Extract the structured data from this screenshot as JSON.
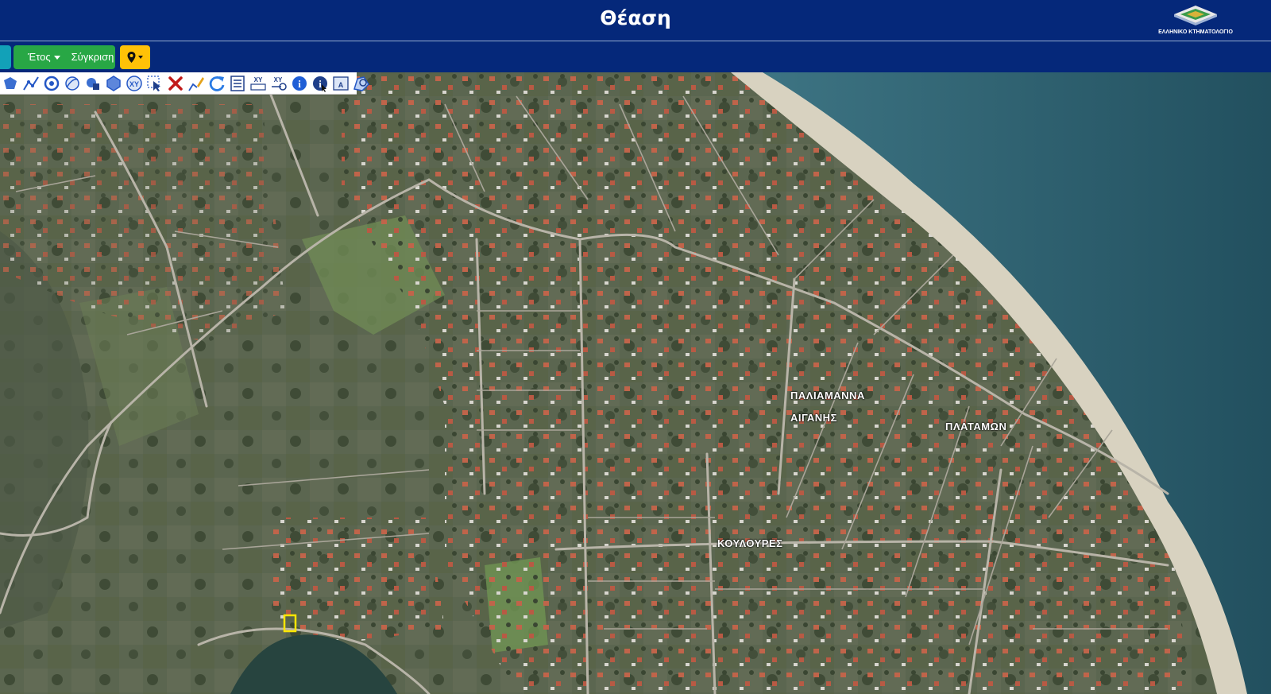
{
  "header": {
    "title": "Θέαση",
    "logo_text": "ΕΛΛΗΝΙΚΟ ΚΤΗΜΑΤΟΛΟΓΙΟ"
  },
  "navbar": {
    "year_label": "Έτος",
    "compare_label": "Σύγκριση",
    "location_icon": "map-marker-icon"
  },
  "toolbar": {
    "tools": [
      "polygon-tool-icon",
      "polyline-tool-icon",
      "circle-tool-icon",
      "freehand-tool-icon",
      "draw-shape-icon",
      "hexagon-tool-icon",
      "xy-point-icon",
      "select-tool-icon",
      "delete-tool-icon",
      "edit-tool-icon",
      "refresh-icon",
      "list-icon",
      "xy-coordinates-icon",
      "xy-goto-icon",
      "info-icon",
      "identify-icon",
      "text-annotation-icon",
      "area-measure-icon"
    ]
  },
  "map": {
    "labels": {
      "paliamanna": "ΠΑΛΙΑΜΑΝΝΑ",
      "aiganis": "ΑΙΓΑΝΗΣ",
      "platamon": "ΠΛΑΤΑΜΩΝ",
      "koulloures": "ΚΟΥΛΟΥΡΕΣ"
    },
    "colors": {
      "land": "#5b6650",
      "sea": "#2c5f72",
      "beach": "#d8d2c0",
      "roads": "#b8b4a8",
      "roofs": "#c0644a",
      "selection": "#ffe600"
    }
  }
}
